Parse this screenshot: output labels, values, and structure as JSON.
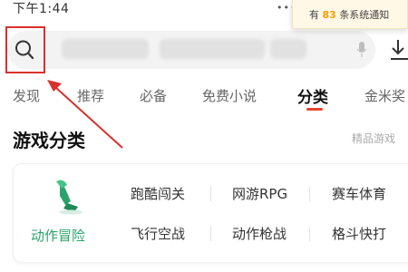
{
  "status_bar": {
    "time": "下午1:44",
    "dots": "•••"
  },
  "notification": {
    "prefix": "有",
    "count": "83",
    "suffix": "条系统通知"
  },
  "tabs": [
    {
      "label": "发现"
    },
    {
      "label": "推荐"
    },
    {
      "label": "必备"
    },
    {
      "label": "免费小说"
    },
    {
      "label": "分类"
    },
    {
      "label": "金米奖"
    }
  ],
  "active_tab": "分类",
  "section": {
    "title": "游戏分类",
    "more": "精品游戏"
  },
  "category": {
    "main_label": "动作冒险",
    "sub_row1": [
      "跑酷闯关",
      "网游RPG",
      "赛车体育"
    ],
    "sub_row2": [
      "飞行空战",
      "动作枪战",
      "格斗快打"
    ]
  },
  "colors": {
    "accent_red": "#e8432f",
    "annotation_red": "#d9302c",
    "category_green": "#2aa36a",
    "notification_orange": "#f0a000"
  },
  "icons": [
    "search-icon",
    "mic-icon",
    "download-icon",
    "sword-icon"
  ]
}
